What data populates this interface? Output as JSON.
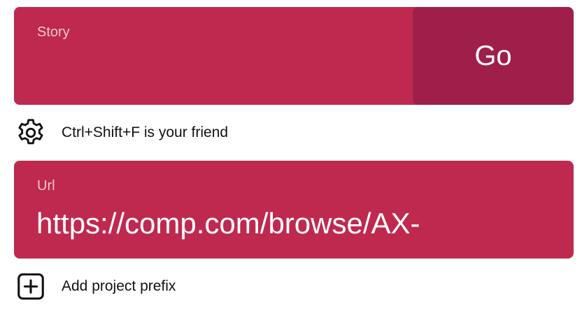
{
  "story": {
    "label": "Story",
    "value": "",
    "go_label": "Go"
  },
  "settings": {
    "icon": "gear-icon",
    "hint": "Ctrl+Shift+F is your friend"
  },
  "url": {
    "label": "Url",
    "value": "https://comp.com/browse/AX-"
  },
  "prefix": {
    "icon": "plus-square-icon",
    "label": "Add project prefix"
  },
  "colors": {
    "card": "#bf294f",
    "button": "#a01f4a",
    "label": "#f0c6d1"
  }
}
